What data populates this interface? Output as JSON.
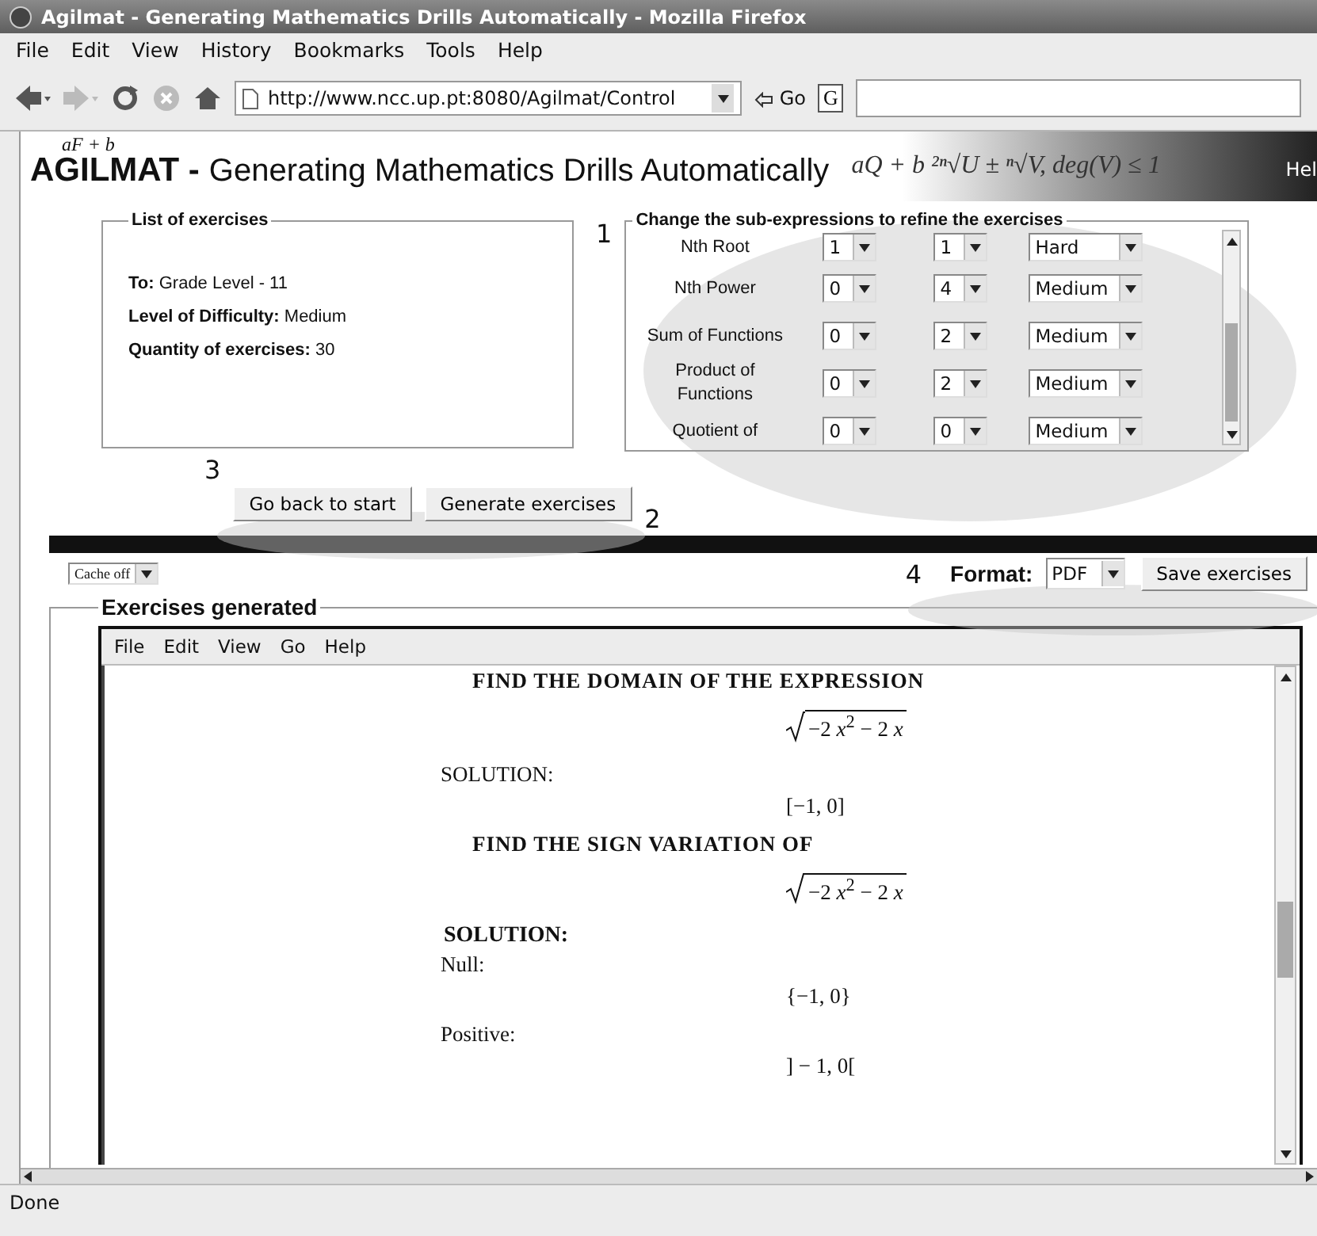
{
  "window": {
    "title": "Agilmat - Generating Mathematics Drills Automatically - Mozilla Firefox"
  },
  "menu": [
    "File",
    "Edit",
    "View",
    "History",
    "Bookmarks",
    "Tools",
    "Help"
  ],
  "toolbar": {
    "url": "http://www.ncc.up.pt:8080/Agilmat/Control",
    "go": "Go",
    "search_engine": "G"
  },
  "banner": {
    "logo": "AGILMAT -",
    "logo_formula": "aF + b",
    "title": "Generating Mathematics Drills Automatically",
    "formula": "aQ + b ²ⁿ√U ± ⁿ√V,  deg(V) ≤ 1",
    "help": "Hel"
  },
  "list_box": {
    "legend": "List of exercises",
    "lines": [
      "**To:** Grade Level - 11",
      "**Level of Difficulty:** Medium",
      "**Quantity of exercises:** 30"
    ]
  },
  "refine_box": {
    "legend": "Change the sub-expressions to refine the exercises",
    "rows": [
      {
        "name": "Nth Root",
        "values": [
          "1",
          "1",
          "Hard"
        ]
      },
      {
        "name": "Nth Power",
        "values": [
          "0",
          "4",
          "Medium"
        ]
      },
      {
        "name": "Sum of Functions",
        "values": [
          "0",
          "2",
          "Medium"
        ]
      },
      {
        "name": "Product of Functions",
        "values": [
          "0",
          "2",
          "Medium"
        ]
      },
      {
        "name": "Quotient of",
        "values": [
          "0",
          "0",
          "Medium"
        ]
      }
    ]
  },
  "annotations": [
    "1",
    "2",
    "3",
    "4"
  ],
  "buttons": [
    "Go back to start",
    "Generate exercises"
  ],
  "cache": "Cache off",
  "format": {
    "label": "Format:",
    "value": "PDF",
    "button": "Save exercises"
  },
  "exercises": {
    "legend": "Exercises generated",
    "menu": [
      "File",
      "Edit",
      "View",
      "Go",
      "Help"
    ],
    "lines": [
      {
        "kind": "heading",
        "text": "FIND THE DOMAIN OF THE EXPRESSION"
      },
      {
        "kind": "math",
        "text": "−2 *x*$^{2}$ − 2 *x*",
        "root": true
      },
      {
        "kind": "label",
        "text": "SOLUTION:"
      },
      {
        "kind": "math",
        "text": "[−1, 0]",
        "root": false
      },
      {
        "kind": "heading",
        "text": "FIND THE SIGN VARIATION OF"
      },
      {
        "kind": "math",
        "text": "−2 *x*$^{2}$ − 2 *x*",
        "root": true
      },
      {
        "kind": "boldlabel",
        "text": "SOLUTION:"
      },
      {
        "kind": "label",
        "text": "Null:"
      },
      {
        "kind": "math",
        "text": "{−1, 0}",
        "root": false
      },
      {
        "kind": "label",
        "text": "Positive:"
      },
      {
        "kind": "math",
        "text": "] − 1, 0[",
        "root": false
      }
    ]
  },
  "status": "Done"
}
